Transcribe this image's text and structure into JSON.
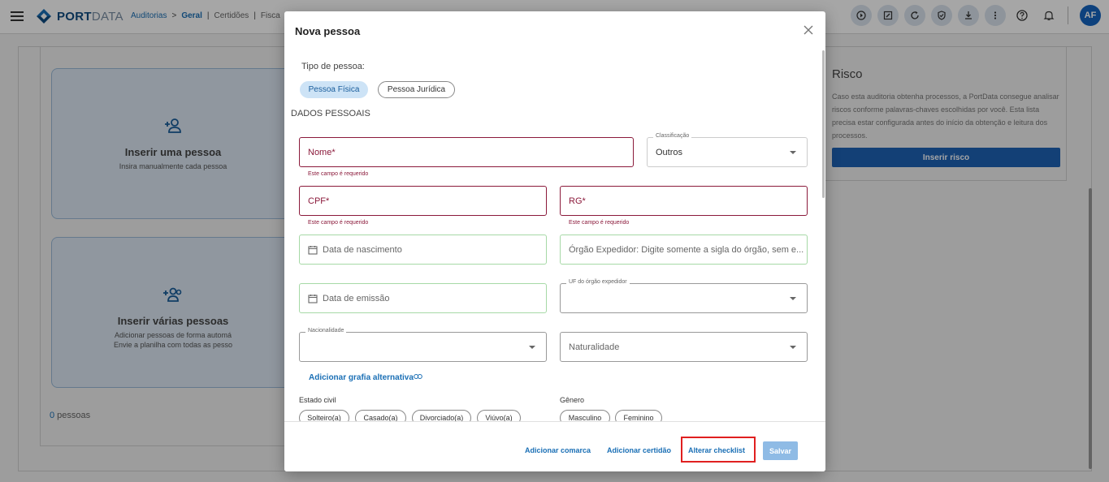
{
  "topbar": {
    "brand_strong": "PORT",
    "brand_light": "DATA",
    "breadcrumb": [
      "Auditorias",
      ">",
      "Geral",
      "|",
      "Certidões",
      "|",
      "Fisca"
    ],
    "avatar": "AF",
    "icons": [
      "play-icon",
      "edit-icon",
      "refresh-icon",
      "shield-check-icon",
      "download-icon",
      "more-vert-icon",
      "help-icon",
      "bell-icon"
    ]
  },
  "background": {
    "card1": {
      "title": "Inserir uma pessoa",
      "desc": "Insira manualmente cada pessoa"
    },
    "card2": {
      "title": "Inserir várias pessoas",
      "desc1": "Adicionar pessoas de forma automá",
      "desc2": "Envie a planilha com todas as pesso"
    },
    "count": "0",
    "count_label": " pessoas",
    "risk": {
      "title": "Risco",
      "text": "Caso esta auditoria obtenha processos, a PortData consegue analisar riscos conforme palavras-chaves escolhidas por você. Esta lista precisa estar configurada antes do início da obtenção e leitura dos processos.",
      "button": "Inserir risco"
    }
  },
  "modal": {
    "title": "Nova pessoa",
    "tipo_label": "Tipo de pessoa:",
    "tipo_options": [
      "Pessoa Física",
      "Pessoa Jurídica"
    ],
    "tipo_selected": "Pessoa Física",
    "section": "DADOS PESSOAIS",
    "fields": {
      "nome": "Nome*",
      "classificacao_label": "Classificação",
      "classificacao_value": "Outros",
      "cpf": "CPF*",
      "rg": "RG*",
      "nascimento": "Data de nascimento",
      "orgao": "Órgão Expedidor: Digite somente a sigla do órgão, sem e...",
      "emissao": "Data de emissão",
      "uf_label": "UF do órgão expedidor",
      "nacionalidade_label": "Nacionalidade",
      "naturalidade": "Naturalidade"
    },
    "error": "Este campo é requerido",
    "alt_link": "Adicionar grafia alternativa",
    "estado_civil_label": "Estado civil",
    "estado_civil_options": [
      "Solteiro(a)",
      "Casado(a)",
      "Divorciado(a)",
      "Viúvo(a)"
    ],
    "genero_label": "Gênero",
    "genero_options": [
      "Masculino",
      "Feminino"
    ],
    "footer": {
      "comarca": "Adicionar comarca",
      "certidao": "Adicionar certidão",
      "checklist": "Alterar checklist",
      "save": "Salvar"
    }
  }
}
